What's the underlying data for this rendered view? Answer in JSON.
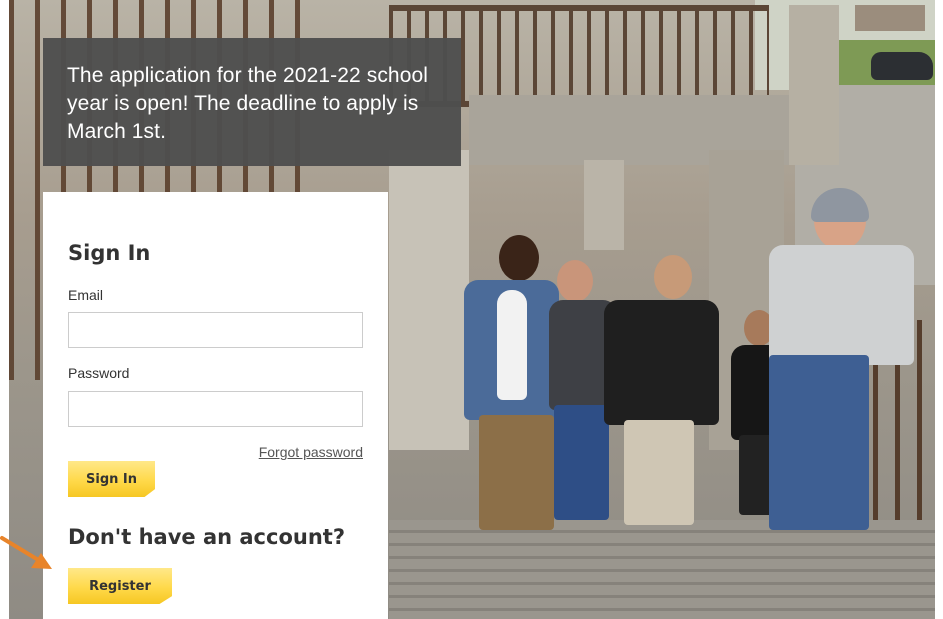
{
  "announcement": "The application for the 2021-22 school year is open! The deadline to apply is March 1st.",
  "signin": {
    "title": "Sign In",
    "email_label": "Email",
    "email_value": "",
    "password_label": "Password",
    "password_value": "",
    "forgot_password": "Forgot password",
    "signin_button": "Sign In"
  },
  "register": {
    "heading": "Don't have an account?",
    "button": "Register"
  },
  "colors": {
    "button_yellow": "#ffd94a",
    "notice_bg": "#4e4e4e",
    "arrow": "#e8842a"
  },
  "icons": [
    "annotation-arrow-icon"
  ]
}
